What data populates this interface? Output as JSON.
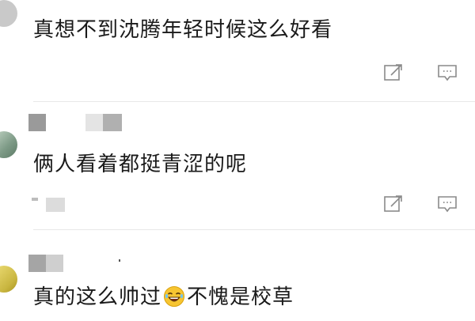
{
  "comments": [
    {
      "text": "真想不到沈腾年轻时候这么好看",
      "reply_icon": "edit-icon",
      "comment_icon": "comment-icon"
    },
    {
      "text": "俩人看着都挺青涩的呢",
      "reply_icon": "edit-icon",
      "comment_icon": "comment-icon"
    },
    {
      "text_before_emoji": "真的这么帅过",
      "emoji": "laughing-emoji",
      "text_after_emoji": "不愧是校草"
    }
  ],
  "colors": {
    "text": "#1a1a1a",
    "icon": "#8a8a8a",
    "mosaic_dark": "#9a9a9a",
    "mosaic_light": "#d9d9d9"
  }
}
